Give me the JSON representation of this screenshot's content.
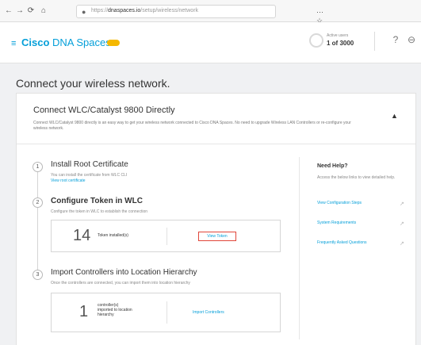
{
  "browser": {
    "back_icon": "←",
    "forward_icon": "→",
    "reload_icon": "⟳",
    "home_icon": "⌂",
    "lock_icon": "🔒",
    "url_prefix": "https://",
    "url_domain": "dnaspaces.io",
    "url_path": "/setup/wireless/network",
    "actions": "⋯ ☆ ✩"
  },
  "header": {
    "menu_icon": "≡",
    "brand_bold": "Cisco",
    "brand_rest": " DNA Spaces",
    "usage_label": "Active users",
    "usage_value": "1 of 3000",
    "help_icon": "?",
    "user_icon": "⊖",
    "accent": "#049fd9",
    "badge_color": "#f5b800"
  },
  "page": {
    "title": "Connect your wireless network."
  },
  "card": {
    "title": "Connect WLC/Catalyst 9800 Directly",
    "description": "Connect WLC/Catalyst 9800 directly is an easy way to get your wireless network connected to Cisco DNA Spaces. No need to upgrade Wireless LAN Controllers or re-configure your wireless network.",
    "collapse_icon": "▲"
  },
  "steps": [
    {
      "number": "1",
      "title": "Install Root Certificate",
      "description": "You can install the certificate from WLC CLI",
      "link": "View root certificate"
    },
    {
      "number": "2",
      "title": "Configure Token in WLC",
      "description": "Configure the token in WLC to establish the connection",
      "count": "14",
      "count_label": "Token installed(s)",
      "action": "View Token"
    },
    {
      "number": "3",
      "title": "Import Controllers into Location Hierarchy",
      "description": "Once the controllers are connected, you can import them into location hierarchy",
      "count": "1",
      "count_label_1": "controller(s)",
      "count_label_2": "imported to location",
      "count_label_3": "hierarchy",
      "action": "Import Controllers"
    }
  ],
  "help": {
    "title": "Need Help?",
    "description": "Access the below links to view detailed help.",
    "links": [
      {
        "label": "View Configuration Steps"
      },
      {
        "label": "System Requirements"
      },
      {
        "label": "Frequently Asked Questions"
      }
    ],
    "ext_icon": "↗"
  }
}
